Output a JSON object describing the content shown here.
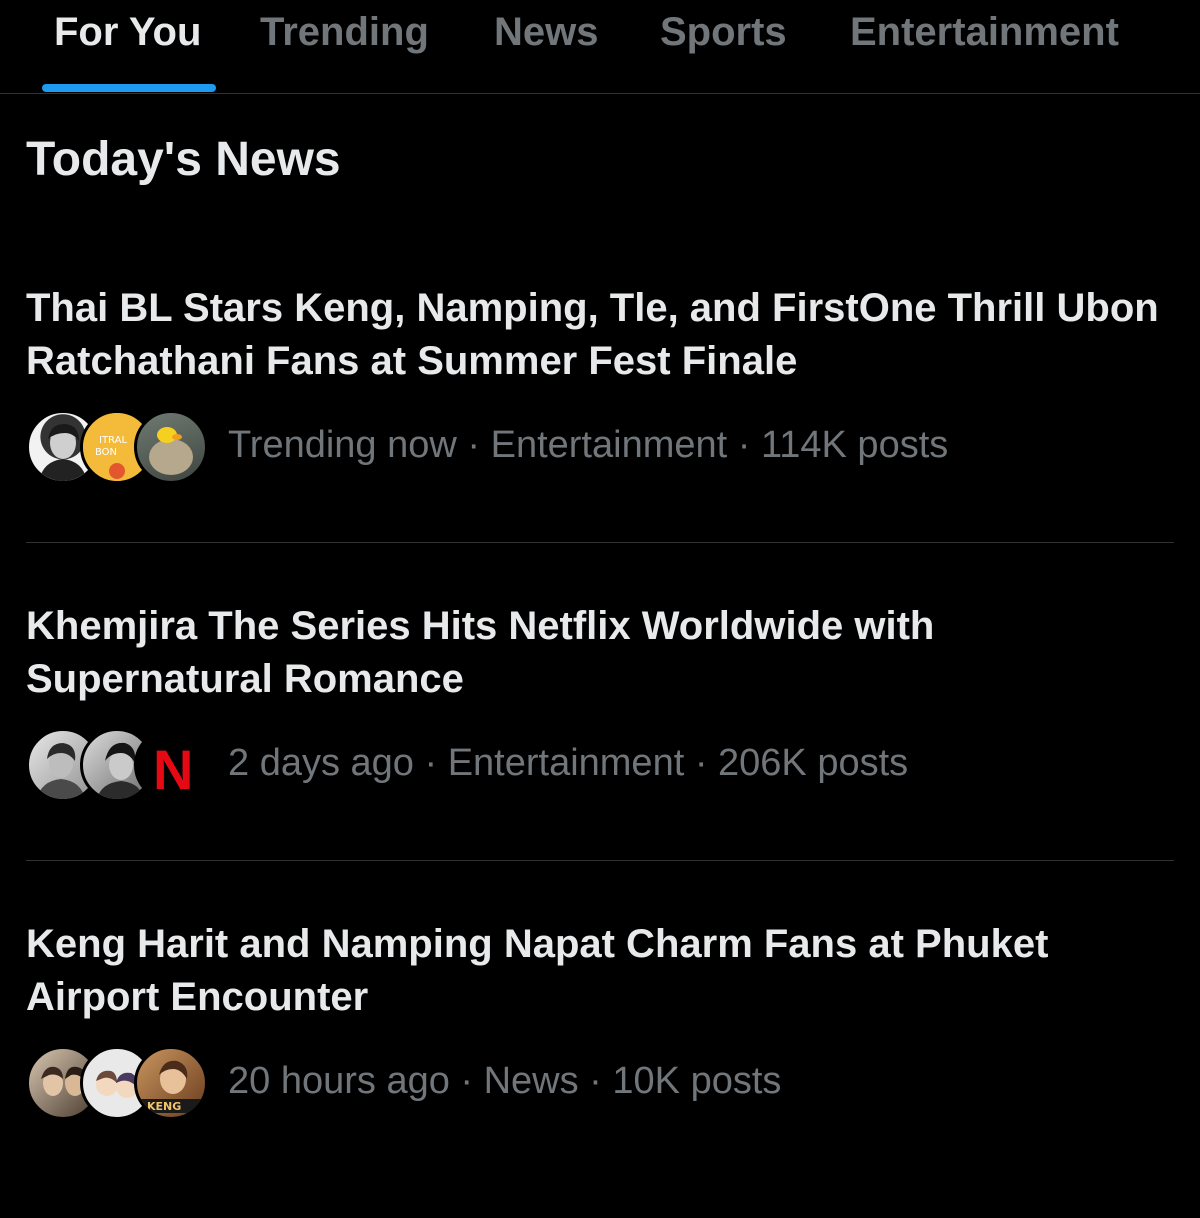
{
  "tabs": [
    "For You",
    "Trending",
    "News",
    "Sports",
    "Entertainment"
  ],
  "section_title": "Today's News",
  "stories": [
    {
      "headline": "Thai BL Stars Keng, Namping, Tle, and FirstOne Thrill Ubon Ratchathani Fans at Summer Fest Finale",
      "meta": "Trending now · Entertainment · 114K posts",
      "avatar_texts": [
        "ITRAL",
        "BON"
      ]
    },
    {
      "headline": "Khemjira The Series Hits Netflix Worldwide with Supernatural Romance",
      "meta": "2 days ago · Entertainment · 206K posts",
      "avatar_texts": [
        "N"
      ]
    },
    {
      "headline": "Keng Harit and Namping Napat Charm Fans at Phuket Airport Encounter",
      "meta": "20 hours ago · News · 10K posts",
      "avatar_texts": [
        "KENG"
      ]
    }
  ],
  "colors": {
    "background": "#000000",
    "text_primary": "#e7e9ea",
    "text_secondary": "#71767b",
    "accent": "#1d9bf0",
    "divider": "#2f3336",
    "netflix_red": "#e50914"
  }
}
